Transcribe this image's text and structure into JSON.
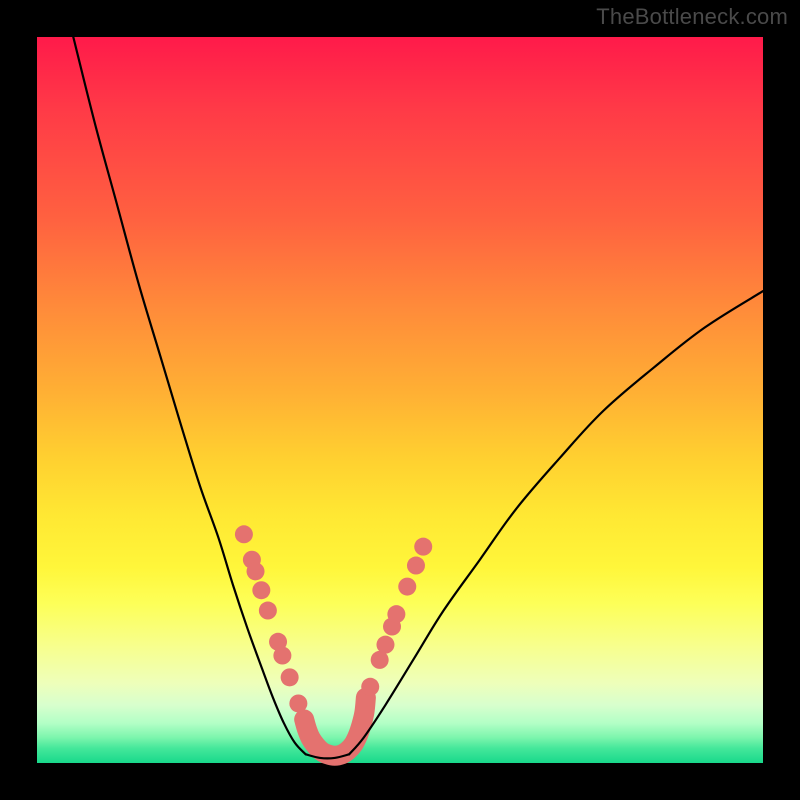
{
  "watermark": "TheBottleneck.com",
  "chart_data": {
    "type": "line",
    "title": "",
    "xlabel": "",
    "ylabel": "",
    "xlim": [
      0,
      100
    ],
    "ylim": [
      0,
      100
    ],
    "series": [
      {
        "name": "curve-left",
        "x": [
          5,
          8,
          11,
          14,
          17,
          20,
          22.5,
          25,
          27,
          29,
          31,
          32.5,
          34,
          35.5,
          37
        ],
        "y": [
          100,
          88,
          77,
          66,
          56,
          46,
          38,
          31,
          24.5,
          18.5,
          13,
          9,
          5.5,
          2.8,
          1.2
        ]
      },
      {
        "name": "curve-right",
        "x": [
          43,
          45,
          48,
          52,
          56,
          61,
          66,
          72,
          78,
          85,
          92,
          100
        ],
        "y": [
          1.2,
          3.5,
          8,
          14.5,
          21,
          28,
          35,
          42,
          48.5,
          54.5,
          60,
          65
        ]
      },
      {
        "name": "valley-floor",
        "x": [
          37,
          39,
          41,
          43
        ],
        "y": [
          1.2,
          0.7,
          0.7,
          1.2
        ]
      }
    ],
    "markers": {
      "name": "salmon-dots",
      "color": "#e4726f",
      "radius_px": 9,
      "points": [
        {
          "x": 28.5,
          "y": 31.5
        },
        {
          "x": 29.6,
          "y": 28.0
        },
        {
          "x": 30.1,
          "y": 26.4
        },
        {
          "x": 30.9,
          "y": 23.8
        },
        {
          "x": 31.8,
          "y": 21.0
        },
        {
          "x": 33.2,
          "y": 16.7
        },
        {
          "x": 33.8,
          "y": 14.8
        },
        {
          "x": 34.8,
          "y": 11.8
        },
        {
          "x": 36.0,
          "y": 8.2
        },
        {
          "x": 36.8,
          "y": 6.0
        },
        {
          "x": 45.3,
          "y": 9.0
        },
        {
          "x": 45.9,
          "y": 10.5
        },
        {
          "x": 47.2,
          "y": 14.2
        },
        {
          "x": 48.0,
          "y": 16.3
        },
        {
          "x": 48.9,
          "y": 18.8
        },
        {
          "x": 49.5,
          "y": 20.5
        },
        {
          "x": 51.0,
          "y": 24.3
        },
        {
          "x": 52.2,
          "y": 27.2
        },
        {
          "x": 53.2,
          "y": 29.8
        }
      ]
    },
    "capsule_band": {
      "name": "valley-capsule",
      "color": "#e4726f",
      "radius_px": 10,
      "path_xy": [
        [
          36.8,
          6.0
        ],
        [
          37.2,
          4.6
        ],
        [
          37.7,
          3.4
        ],
        [
          38.4,
          2.4
        ],
        [
          39.2,
          1.6
        ],
        [
          40.0,
          1.2
        ],
        [
          41.0,
          1.0
        ],
        [
          42.0,
          1.2
        ],
        [
          42.8,
          1.7
        ],
        [
          43.6,
          2.6
        ],
        [
          44.2,
          3.8
        ],
        [
          44.7,
          5.3
        ],
        [
          45.1,
          7.0
        ],
        [
          45.3,
          9.0
        ]
      ]
    }
  }
}
